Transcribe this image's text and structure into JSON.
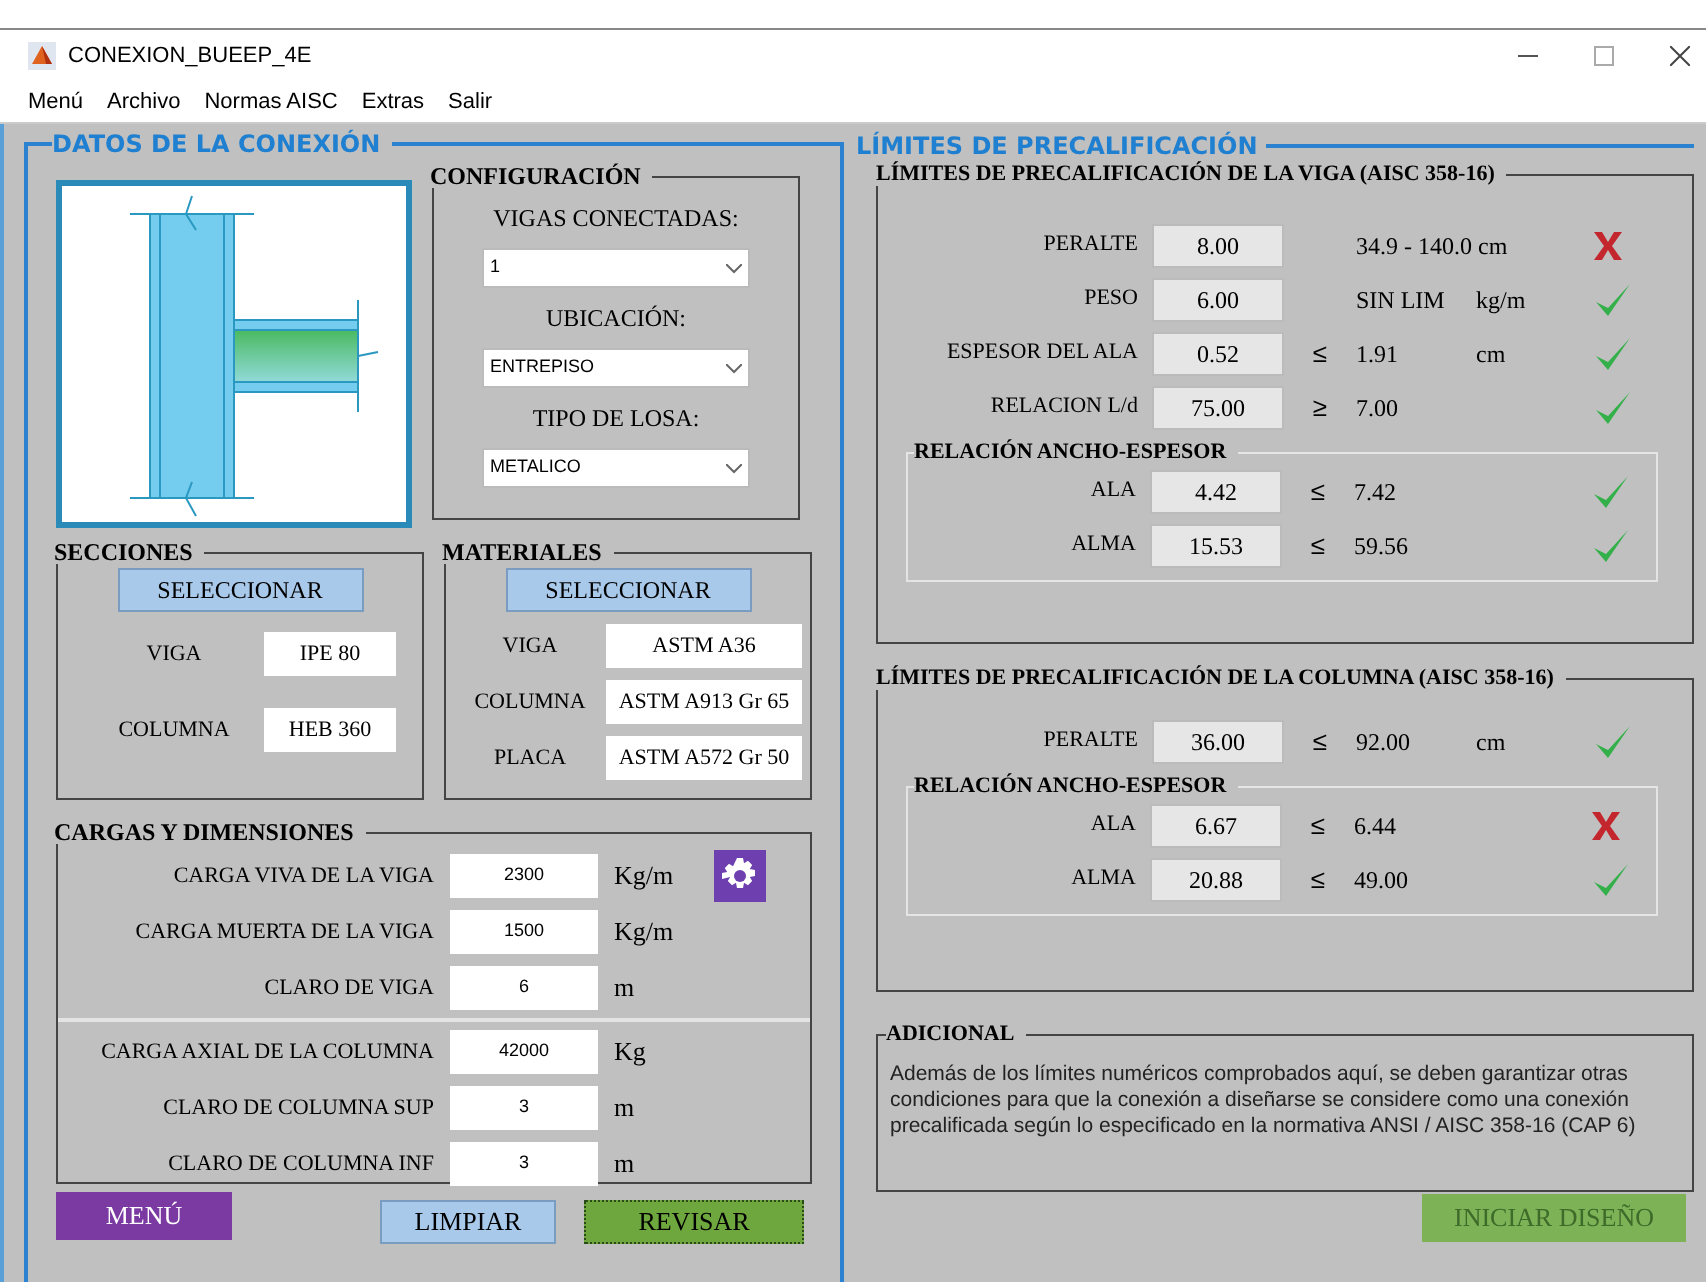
{
  "window": {
    "title": "CONEXION_BUEEP_4E"
  },
  "menu": [
    "Menú",
    "Archivo",
    "Normas AISC",
    "Extras",
    "Salir"
  ],
  "connection": {
    "title": "DATOS DE LA CONEXIÓN",
    "configuration": {
      "title": "CONFIGURACIÓN",
      "dropdowns": [
        {
          "label": "VIGAS CONECTADAS:",
          "value": "1"
        },
        {
          "label": "UBICACIÓN:",
          "value": "ENTREPISO"
        },
        {
          "label": "TIPO DE LOSA:",
          "value": "METALICO"
        }
      ]
    },
    "sections": {
      "title": "SECCIONES",
      "button": "SELECCIONAR",
      "fields": [
        {
          "label": "VIGA",
          "value": "IPE 80"
        },
        {
          "label": "COLUMNA",
          "value": "HEB 360"
        }
      ]
    },
    "materials": {
      "title": "MATERIALES",
      "button": "SELECCIONAR",
      "fields": [
        {
          "label": "VIGA",
          "value": "ASTM A36"
        },
        {
          "label": "COLUMNA",
          "value": "ASTM A913 Gr 65"
        },
        {
          "label": "PLACA",
          "value": "ASTM A572 Gr 50"
        }
      ]
    },
    "loads": {
      "title": "CARGAS Y DIMENSIONES",
      "beam_rows": [
        {
          "label": "CARGA VIVA DE LA VIGA",
          "value": "2300",
          "unit": "Kg/m"
        },
        {
          "label": "CARGA MUERTA DE LA VIGA",
          "value": "1500",
          "unit": "Kg/m"
        },
        {
          "label": "CLARO DE VIGA",
          "value": "6",
          "unit": "m"
        }
      ],
      "column_rows": [
        {
          "label": "CARGA AXIAL DE LA COLUMNA",
          "value": "42000",
          "unit": "Kg"
        },
        {
          "label": "CLARO DE COLUMNA SUP",
          "value": "3",
          "unit": "m"
        },
        {
          "label": "CLARO DE COLUMNA INF",
          "value": "3",
          "unit": "m"
        }
      ]
    },
    "buttons": [
      {
        "label": "MENÚ",
        "kind": "menu"
      },
      {
        "label": "LIMPIAR",
        "kind": "clear"
      },
      {
        "label": "REVISAR",
        "kind": "check"
      }
    ]
  },
  "limits": {
    "title": "LÍMITES DE PRECALIFICACIÓN",
    "beam": {
      "title": "LÍMITES DE PRECALIFICACIÓN DE LA VIGA (AISC 358-16)",
      "checks": [
        {
          "label": "PERALTE",
          "value": "8.00",
          "limit": "34.9 - 140.0 cm",
          "pass": false
        },
        {
          "label": "PESO",
          "value": "6.00",
          "limit": "SIN LIM",
          "unit": "kg/m",
          "pass": true
        },
        {
          "label": "ESPESOR DEL ALA",
          "value": "0.52",
          "operator": "≤",
          "limit": "1.91",
          "unit": "cm",
          "pass": true
        },
        {
          "label": "RELACION L/d",
          "value": "75.00",
          "operator": "≥",
          "limit": "7.00",
          "pass": true
        }
      ],
      "ratio": {
        "title": "RELACIÓN ANCHO-ESPESOR",
        "checks": [
          {
            "label": "ALA",
            "value": "4.42",
            "operator": "≤",
            "limit": "7.42",
            "pass": true
          },
          {
            "label": "ALMA",
            "value": "15.53",
            "operator": "≤",
            "limit": "59.56",
            "pass": true
          }
        ]
      }
    },
    "column": {
      "title": "LÍMITES DE PRECALIFICACIÓN DE LA COLUMNA (AISC 358-16)",
      "checks": [
        {
          "label": "PERALTE",
          "value": "36.00",
          "operator": "≤",
          "limit": "92.00",
          "unit": "cm",
          "pass": true
        }
      ],
      "ratio": {
        "title": "RELACIÓN ANCHO-ESPESOR",
        "checks": [
          {
            "label": "ALA",
            "value": "6.67",
            "operator": "≤",
            "limit": "6.44",
            "pass": false
          },
          {
            "label": "ALMA",
            "value": "20.88",
            "operator": "≤",
            "limit": "49.00",
            "pass": true
          }
        ]
      }
    },
    "additional": {
      "title": "ADICIONAL",
      "text": "Además de los límites numéricos comprobados aquí, se deben garantizar otras condiciones para que la conexión a diseñarse se considere como una conexión precalificada según lo especificado en la normativa ANSI / AISC 358-16 (CAP 6)"
    },
    "start_button": {
      "label": "INICIAR DISEÑO",
      "disabled": true
    }
  }
}
